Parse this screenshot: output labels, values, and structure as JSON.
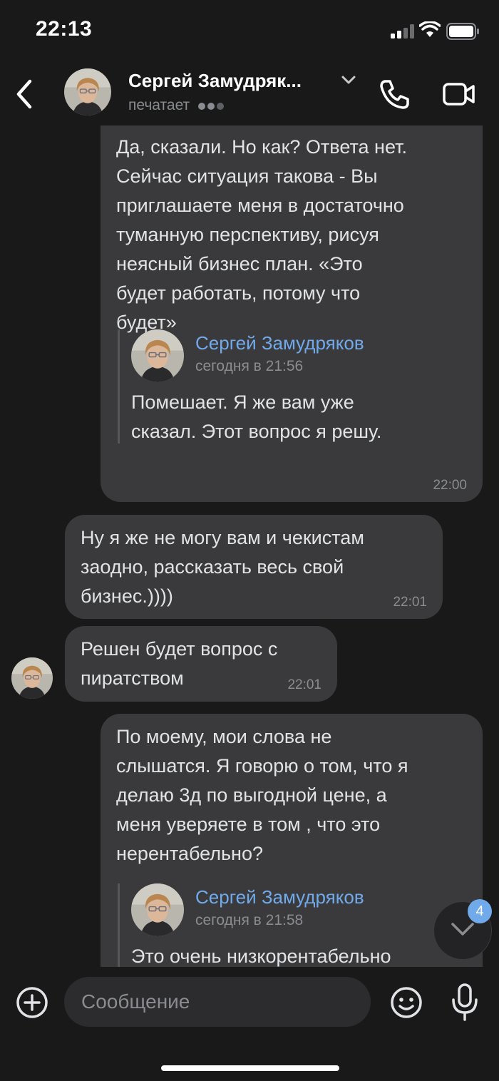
{
  "status_bar": {
    "time": "22:13"
  },
  "header": {
    "contact_name": "Сергей Замудряк...",
    "status": "печатает"
  },
  "messages": [
    {
      "direction": "outgoing",
      "text": "Да, сказали. Но как? Ответа нет.\nСейчас  ситуация такова - Вы\nприглашаете меня в достаточно\nтуманную перспективу, рисуя\nнеясный бизнес план. «Это\nбудет работать, потому что\nбудет»",
      "reply": {
        "author": "Сергей Замудряков",
        "date": "сегодня в 21:56",
        "text": "Помешает. Я же вам уже\nсказал. Этот вопрос я решу."
      },
      "time": "22:00"
    },
    {
      "direction": "incoming",
      "text": "Ну я же не могу вам и чекистам\nзаодно, рассказать весь свой\nбизнес.))))",
      "time": "22:01"
    },
    {
      "direction": "incoming",
      "text": "Решен будет вопрос с\nпиратством",
      "time": "22:01"
    },
    {
      "direction": "outgoing",
      "text": "По моему, мои слова не\nслышатся. Я говорю о том, что я\nделаю 3д по выгодной цене, а\nменя уверяете в том , что это\nнерентабельно?",
      "reply": {
        "author": "Сергей Замудряков",
        "date": "сегодня в 21:58",
        "text": "Это очень низкорентабельно"
      }
    }
  ],
  "scroll_down": {
    "unread_count": "4"
  },
  "composer": {
    "placeholder": "Сообщение"
  },
  "colors": {
    "background": "#19191a",
    "bubble": "#3a3a3c",
    "accent": "#71aaeb",
    "secondary_text": "#8a8c91"
  }
}
